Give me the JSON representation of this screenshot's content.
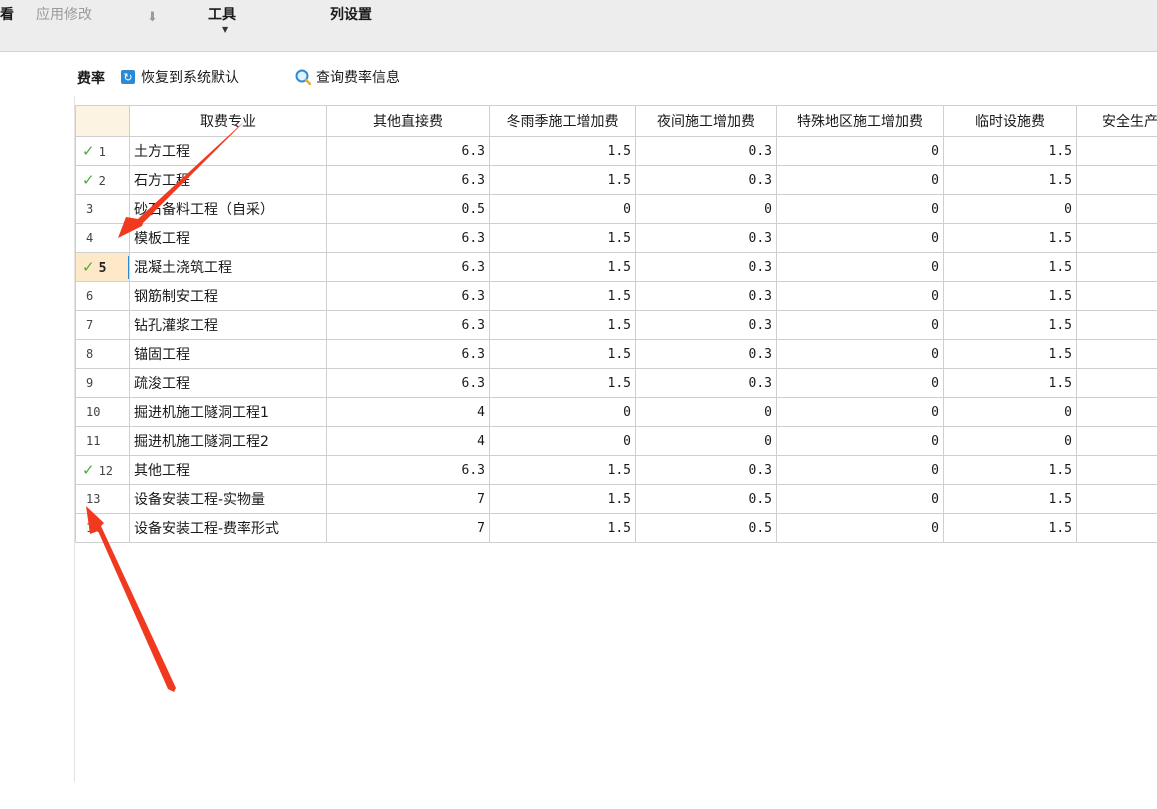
{
  "toolbar": {
    "edge_label": "看",
    "apply_changes": "应用修改",
    "tools": "工具",
    "column_settings": "列设置"
  },
  "rate_bar": {
    "title": "费率",
    "restore_default": "恢复到系统默认",
    "query_rate_info": "查询费率信息"
  },
  "table": {
    "columns": [
      "",
      "取费专业",
      "其他直接费",
      "冬雨季施工增加费",
      "夜间施工增加费",
      "特殊地区施工增加费",
      "临时设施费",
      "安全生产措"
    ],
    "rows": [
      {
        "idx": "1",
        "checked": true,
        "selected": false,
        "name": "土方工程",
        "c1": "6.3",
        "c2": "1.5",
        "c3": "0.3",
        "c4": "0",
        "c5": "1.5"
      },
      {
        "idx": "2",
        "checked": true,
        "selected": false,
        "name": "石方工程",
        "c1": "6.3",
        "c2": "1.5",
        "c3": "0.3",
        "c4": "0",
        "c5": "1.5"
      },
      {
        "idx": "3",
        "checked": false,
        "selected": false,
        "name": "砂石备料工程（自采）",
        "c1": "0.5",
        "c2": "0",
        "c3": "0",
        "c4": "0",
        "c5": "0"
      },
      {
        "idx": "4",
        "checked": false,
        "selected": false,
        "name": "模板工程",
        "c1": "6.3",
        "c2": "1.5",
        "c3": "0.3",
        "c4": "0",
        "c5": "1.5"
      },
      {
        "idx": "5",
        "checked": true,
        "selected": true,
        "name": "混凝土浇筑工程",
        "c1": "6.3",
        "c2": "1.5",
        "c3": "0.3",
        "c4": "0",
        "c5": "1.5"
      },
      {
        "idx": "6",
        "checked": false,
        "selected": false,
        "name": "钢筋制安工程",
        "c1": "6.3",
        "c2": "1.5",
        "c3": "0.3",
        "c4": "0",
        "c5": "1.5"
      },
      {
        "idx": "7",
        "checked": false,
        "selected": false,
        "name": "钻孔灌浆工程",
        "c1": "6.3",
        "c2": "1.5",
        "c3": "0.3",
        "c4": "0",
        "c5": "1.5"
      },
      {
        "idx": "8",
        "checked": false,
        "selected": false,
        "name": "锚固工程",
        "c1": "6.3",
        "c2": "1.5",
        "c3": "0.3",
        "c4": "0",
        "c5": "1.5"
      },
      {
        "idx": "9",
        "checked": false,
        "selected": false,
        "name": "疏浚工程",
        "c1": "6.3",
        "c2": "1.5",
        "c3": "0.3",
        "c4": "0",
        "c5": "1.5"
      },
      {
        "idx": "10",
        "checked": false,
        "selected": false,
        "name": "掘进机施工隧洞工程1",
        "c1": "4",
        "c2": "0",
        "c3": "0",
        "c4": "0",
        "c5": "0"
      },
      {
        "idx": "11",
        "checked": false,
        "selected": false,
        "name": "掘进机施工隧洞工程2",
        "c1": "4",
        "c2": "0",
        "c3": "0",
        "c4": "0",
        "c5": "0"
      },
      {
        "idx": "12",
        "checked": true,
        "selected": false,
        "name": "其他工程",
        "c1": "6.3",
        "c2": "1.5",
        "c3": "0.3",
        "c4": "0",
        "c5": "1.5"
      },
      {
        "idx": "13",
        "checked": false,
        "selected": false,
        "name": "设备安装工程-实物量",
        "c1": "7",
        "c2": "1.5",
        "c3": "0.5",
        "c4": "0",
        "c5": "1.5"
      },
      {
        "idx": "14",
        "checked": false,
        "selected": false,
        "name": "设备安装工程-费率形式",
        "c1": "7",
        "c2": "1.5",
        "c3": "0.5",
        "c4": "0",
        "c5": "1.5"
      }
    ]
  },
  "colors": {
    "check": "#4caa3d",
    "selected_row_header": "#fde8c8",
    "annotation_arrow": "#f0391e",
    "accent": "#2b8ad6"
  }
}
